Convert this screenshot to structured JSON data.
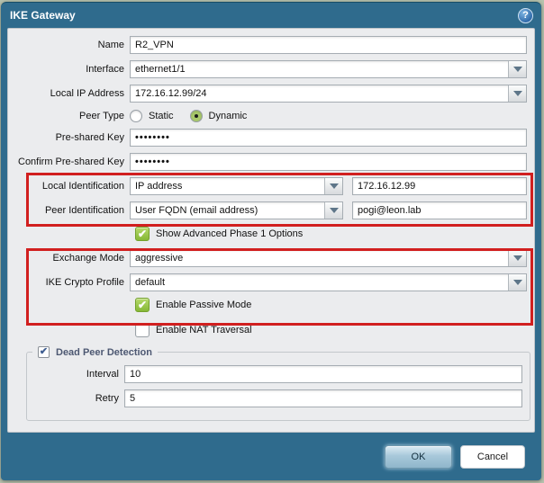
{
  "dialog": {
    "title": "IKE Gateway"
  },
  "icons": {
    "help": "?",
    "check": "✔"
  },
  "colors": {
    "frame_teal": "#2f6b8d",
    "body_gray": "#ebecee",
    "annotation_red": "#d11f1f",
    "checkbox_green": "#8cbf3f",
    "ok_button_blue": "#a8c8da"
  },
  "fields": {
    "name": {
      "label": "Name",
      "value": "R2_VPN"
    },
    "interface": {
      "label": "Interface",
      "value": "ethernet1/1"
    },
    "local_ip": {
      "label": "Local IP Address",
      "value": "172.16.12.99/24"
    },
    "peer_type": {
      "label": "Peer Type",
      "options": [
        {
          "label": "Static",
          "selected": false
        },
        {
          "label": "Dynamic",
          "selected": true
        }
      ]
    },
    "preshared_key": {
      "label": "Pre-shared Key",
      "value": "••••••••"
    },
    "confirm_preshared_key": {
      "label": "Confirm Pre-shared Key",
      "value": "••••••••"
    },
    "local_identification": {
      "label": "Local Identification",
      "type_value": "IP address",
      "value": "172.16.12.99"
    },
    "peer_identification": {
      "label": "Peer Identification",
      "type_value": "User FQDN (email address)",
      "value": "pogi@leon.lab"
    },
    "show_advanced": {
      "label": "Show Advanced Phase 1 Options",
      "checked": true
    },
    "exchange_mode": {
      "label": "Exchange Mode",
      "value": "aggressive"
    },
    "ike_crypto_profile": {
      "label": "IKE Crypto Profile",
      "value": "default"
    },
    "enable_passive_mode": {
      "label": "Enable Passive Mode",
      "checked": true
    },
    "enable_nat_traversal": {
      "label": "Enable NAT Traversal",
      "checked": false
    },
    "dead_peer_detection": {
      "label": "Dead Peer Detection",
      "checked": true,
      "interval": {
        "label": "Interval",
        "value": "10"
      },
      "retry": {
        "label": "Retry",
        "value": "5"
      }
    }
  },
  "footer": {
    "ok_label": "OK",
    "cancel_label": "Cancel"
  }
}
